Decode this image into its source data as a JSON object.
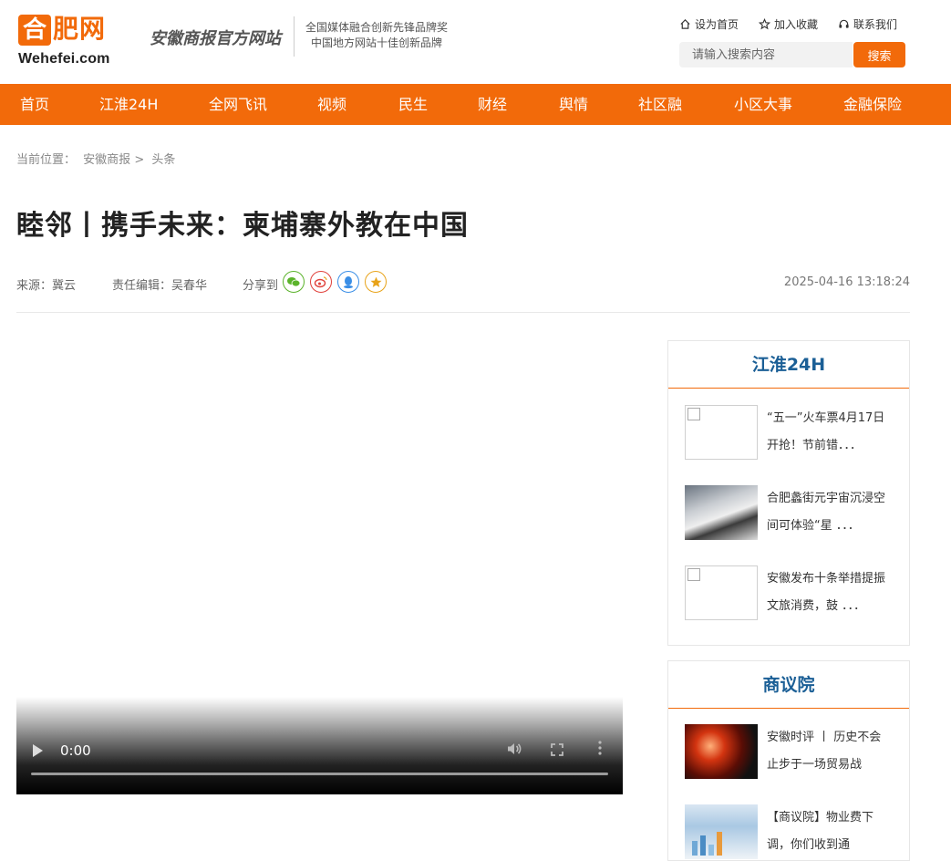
{
  "header": {
    "logo_cn_first": "合",
    "logo_cn_rest": "肥网",
    "logo_en": "Wehefei.com",
    "slogan": "安徽商报官方网站",
    "awards": [
      "全国媒体融合创新先锋品牌奖",
      "中国地方网站十佳创新品牌"
    ],
    "top_links": [
      "设为首页",
      "加入收藏",
      "联系我们"
    ],
    "search_placeholder": "请输入搜索内容",
    "search_button": "搜索"
  },
  "nav": [
    "首页",
    "江淮24H",
    "全网飞讯",
    "视频",
    "民生",
    "财经",
    "舆情",
    "社区融",
    "小区大事",
    "金融保险"
  ],
  "breadcrumb": {
    "label": "当前位置：",
    "items": [
      "安徽商报",
      ">",
      "头条"
    ]
  },
  "article": {
    "title": "睦邻丨携手未来：柬埔寨外教在中国",
    "source": "来源：冀云",
    "editor": "责任编辑：吴春华",
    "share_label": "分享到",
    "time": "2025-04-16 13:18:24"
  },
  "video": {
    "current_time": "0:00"
  },
  "sidebar": [
    {
      "title": "江淮24H",
      "items": [
        {
          "text": "“五一”火车票4月17日开抢！节前错．．．"
        },
        {
          "text": "合肥蠡街元宇宙沉浸空间可体验“星 ．．．"
        },
        {
          "text": "安徽发布十条举措提振文旅消费，鼓 ．．．"
        }
      ]
    },
    {
      "title": "商议院",
      "items": [
        {
          "text": "安徽时评 丨 历史不会止步于一场贸易战"
        },
        {
          "text": "【商议院】物业费下调，你们收到通"
        }
      ]
    }
  ],
  "colors": {
    "brand_orange": "#f26a0a",
    "sidebar_title_blue": "#1b5f96"
  }
}
